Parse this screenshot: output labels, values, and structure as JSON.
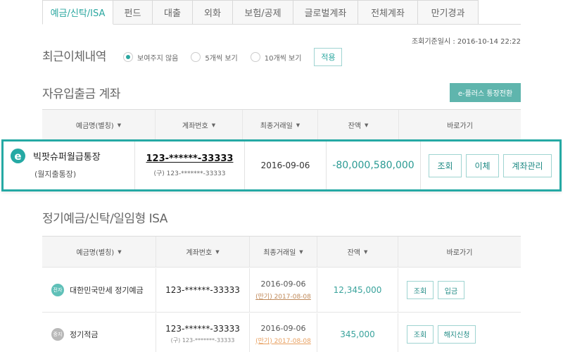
{
  "tabs": [
    "예금/신탁/ISA",
    "펀드",
    "대출",
    "외화",
    "보험/공제",
    "글로벌계좌",
    "전체계좌",
    "만기경과"
  ],
  "timestamp": "조회기준일시 : 2016-10-14 22:22",
  "recent": {
    "title": "최근이체내역",
    "options": [
      "보여주지 않음",
      "5개씩 보기",
      "10개씩 보기"
    ],
    "apply": "적용"
  },
  "free": {
    "title": "자유입출금 계좌",
    "eplus_button": "e-플러스 통장전환",
    "headers": [
      "예금명(별칭)",
      "계좌번호",
      "최종거래일",
      "잔액",
      "바로가기"
    ],
    "row": {
      "badge": "e",
      "name": "빅팟슈퍼월급통장",
      "sub": "(월지출통장)",
      "account": "123-******-33333",
      "old_account": "(구) 123-*******-33333",
      "date": "2016-09-06",
      "balance": "-80,000,580,000",
      "buttons": [
        "조회",
        "이체",
        "계좌관리"
      ]
    }
  },
  "term": {
    "title": "정기예금/신탁/일임형 ISA",
    "headers": [
      "예금명(별칭)",
      "계좌번호",
      "최종거래일",
      "잔액",
      "바로가기"
    ],
    "rows": [
      {
        "badge": "전자",
        "name": "대한민국만세 정기예금",
        "account": "123-******-33333",
        "old_account": "",
        "date": "2016-09-06",
        "maturity": "(만기) 2017-08-08",
        "balance": "12,345,000",
        "buttons": [
          "조회",
          "입금"
        ]
      },
      {
        "badge": "중지",
        "name": "정기적금",
        "account": "123-******-33333",
        "old_account": "(구) 123-*******-33333",
        "date": "2016-09-06",
        "maturity": "(만기) 2017-08-08",
        "balance": "345,000",
        "buttons": [
          "조회",
          "해지신청"
        ]
      }
    ]
  },
  "colors": {
    "accent": "#25a9a4",
    "badge_active": "#5fc0b8",
    "badge_stopped": "#b8b8b8",
    "maturity_orange": "#e8a060"
  }
}
